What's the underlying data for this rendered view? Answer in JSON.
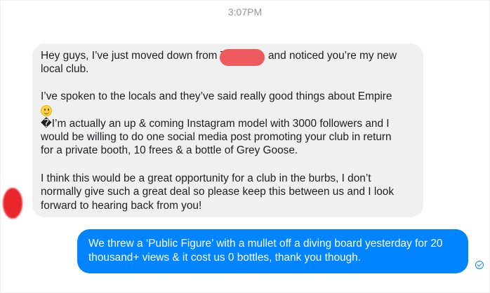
{
  "conversation": {
    "timestamp": "3:07PM",
    "incoming_message": {
      "lines": [
        "Hey guys, I’ve just moved down from T",
        "and noticed you’re my new",
        "local club.",
        "I’ve spoken to the locals and they’ve said really good things about Empire",
        "�I’m actually an up & coming Instagram model with 3000 followers and I",
        "would be willing to do one social media post promoting your club in return",
        "for a private booth, 10 frees & a bottle of Grey Goose.",
        "I think this would be a great opportunity for a club in the burbs, I don’t",
        "normally give such a great deal so please keep this between us and I look",
        "forward to hearing back from you!"
      ],
      "emoji": "slightly-smiling-face-icon",
      "redaction_color": "#ee5b5e",
      "bubble_color": "#f1f0f0"
    },
    "outgoing_message": {
      "lines": [
        "We threw a ‘Public Figure’ with a mullet off a diving board yesterday for 20",
        "thousand+ views & it cost us 0 bottles, thank you though."
      ],
      "bubble_color": "#0084ff",
      "status_icon": "seen-check-icon"
    },
    "sender_avatar_color": "#e8262c"
  }
}
